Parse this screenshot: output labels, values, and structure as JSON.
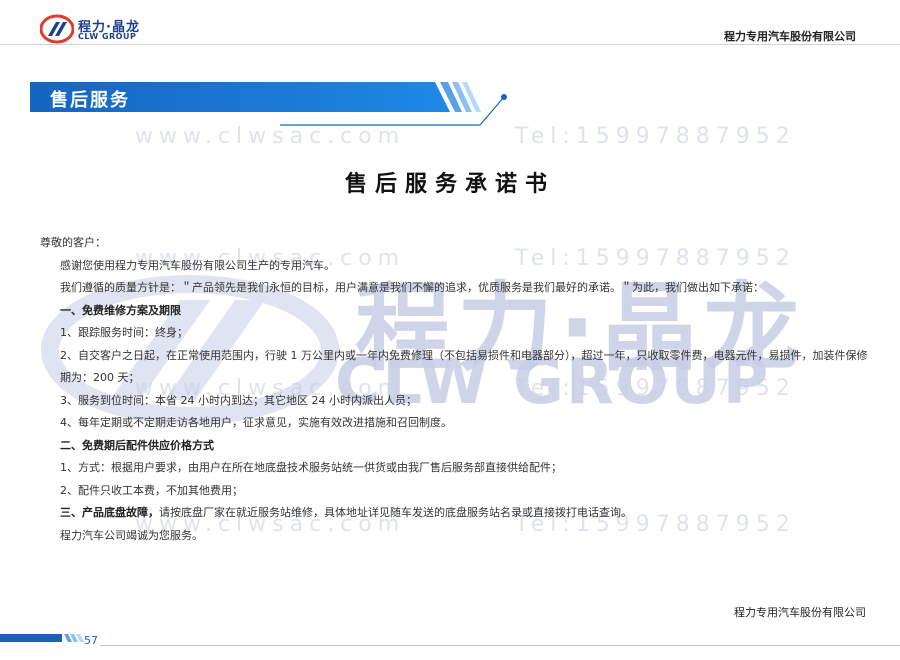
{
  "header": {
    "logo_cn": "程力·晶龙",
    "logo_en": "CLW GROUP",
    "company": "程力专用汽车股份有限公司"
  },
  "banner": {
    "title": "售后服务"
  },
  "watermark": {
    "site": "www.clwsac.com",
    "tel": "Tel:15997887952",
    "brand_cn": "程力·晶龙",
    "brand_en": "CLW GROUP"
  },
  "document": {
    "title": "售后服务承诺书",
    "salutation": "尊敬的客户：",
    "intro1": "感谢您使用程力专用汽车股份有限公司生产的专用汽车。",
    "intro2": "我们遵循的质量方针是：＂产品领先是我们永恒的目标，用户满意是我们不懈的追求，优质服务是我们最好的承诺。＂为此，我们做出如下承诺：",
    "section1": "一、免费维修方案及期限",
    "s1_item1": "1、跟踪服务时间：终身；",
    "s1_item2": "2、自交客户之日起，在正常使用范围内，行驶 1 万公里内或一年内免费修理（不包括易损件和电器部分），超过一年，只收取零件费，电器元件，易损件，加装件保修期为：200 天；",
    "s1_item3": "3、服务到位时间：本省 24 小时内到达；其它地区 24 小时内派出人员；",
    "s1_item4": "4、每年定期或不定期走访各地用户，征求意见，实施有效改进措施和召回制度。",
    "section2": "二、免费期后配件供应价格方式",
    "s2_item1": "1、方式：根据用户要求，由用户在所在地底盘技术服务站统一供货或由我厂售后服务部直接供给配件；",
    "s2_item2": "2、配件只收工本费，不加其他费用；",
    "section3_bold": "三、产品底盘故障，",
    "section3_text": "请按底盘厂家在就近服务站维修，具体地址详见随车发送的底盘服务站名录或直接拨打电话查询。",
    "closing": "程力汽车公司竭诚为您服务。"
  },
  "footer": {
    "company": "程力专用汽车股份有限公司",
    "page": "57"
  },
  "colors": {
    "brand_blue": "#1d5fbf",
    "banner_dark": "#1565c0",
    "watermark": "#c7cde6"
  }
}
